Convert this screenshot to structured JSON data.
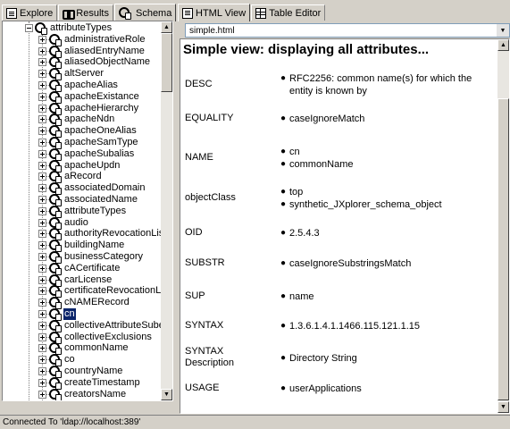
{
  "left_tabs": [
    {
      "label": "Explore",
      "icon": "explore-icon"
    },
    {
      "label": "Results",
      "icon": "results-icon"
    },
    {
      "label": "Schema",
      "icon": "schema-icon"
    }
  ],
  "tree": {
    "root": "attributeTypes",
    "items": [
      "administrativeRole",
      "aliasedEntryName",
      "aliasedObjectName",
      "altServer",
      "apacheAlias",
      "apacheExistance",
      "apacheHierarchy",
      "apacheNdn",
      "apacheOneAlias",
      "apacheSamType",
      "apacheSubalias",
      "apacheUpdn",
      "aRecord",
      "associatedDomain",
      "associatedName",
      "attributeTypes",
      "audio",
      "authorityRevocationList",
      "buildingName",
      "businessCategory",
      "cACertificate",
      "carLicense",
      "certificateRevocationList",
      "cNAMERecord",
      "cn",
      "collectiveAttributeSubentries",
      "collectiveExclusions",
      "commonName",
      "co",
      "countryName",
      "createTimestamp",
      "creatorsName"
    ],
    "selected": "cn"
  },
  "right_tabs": [
    {
      "label": "HTML View",
      "icon": "html-view-icon"
    },
    {
      "label": "Table Editor",
      "icon": "table-editor-icon"
    }
  ],
  "address": "simple.html",
  "view": {
    "heading": "Simple view: displaying all attributes...",
    "attributes": [
      {
        "name": "DESC",
        "values": [
          "RFC2256: common name(s) for which the entity is known by"
        ]
      },
      {
        "name": "EQUALITY",
        "values": [
          "caseIgnoreMatch"
        ]
      },
      {
        "name": "NAME",
        "values": [
          "cn",
          "commonName"
        ]
      },
      {
        "name": "objectClass",
        "values": [
          "top",
          "synthetic_JXplorer_schema_object"
        ]
      },
      {
        "name": "OID",
        "values": [
          "2.5.4.3"
        ]
      },
      {
        "name": "SUBSTR",
        "values": [
          "caseIgnoreSubstringsMatch"
        ]
      },
      {
        "name": "SUP",
        "values": [
          "name"
        ]
      },
      {
        "name": "SYNTAX",
        "values": [
          "1.3.6.1.4.1.1466.115.121.1.15"
        ]
      },
      {
        "name": "SYNTAX Description",
        "values": [
          "Directory String"
        ]
      },
      {
        "name": "USAGE",
        "values": [
          "userApplications"
        ]
      }
    ]
  },
  "status": "Connected To 'ldap://localhost:389'"
}
